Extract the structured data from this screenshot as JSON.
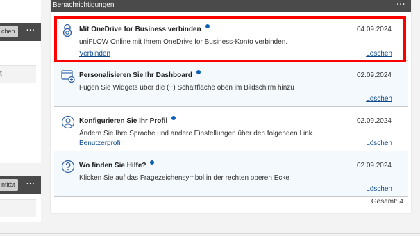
{
  "left": {
    "button_partial": "chen",
    "menu_dots": "···",
    "row_text": "t",
    "bottom_button_partial": "ntität",
    "bottom_menu_dots": "···"
  },
  "panel": {
    "title": "Benachrichtigungen",
    "menu_dots": "···",
    "total": "Gesamt: 4"
  },
  "notifications": [
    {
      "icon": "onedrive-lock-icon",
      "title": "Mit OneDrive for Business verbinden",
      "date": "04.09.2024",
      "description": "uniFLOW Online mit Ihrem OneDrive for Business-Konto verbinden.",
      "link": "Verbinden",
      "delete": "Löschen",
      "highlighted": true
    },
    {
      "icon": "dashboard-add-icon",
      "title": "Personalisieren Sie Ihr Dashboard",
      "date": "02.09.2024",
      "description": "Fügen Sie Widgets über die (+) Schaltfläche oben im Bildschirm hinzu",
      "link": "",
      "delete": "Löschen"
    },
    {
      "icon": "user-profile-icon",
      "title": "Konfigurieren Sie Ihr Profil",
      "date": "02.09.2024",
      "description": "Ändern Sie Ihre Sprache und andere Einstellungen über den folgenden Link.",
      "link": "Benutzerprofil",
      "delete": "Löschen"
    },
    {
      "icon": "help-question-icon",
      "title": "Wo finden Sie Hilfe?",
      "date": "02.09.2024",
      "description": "Klicken Sie auf das Fragezeichensymbol in der rechten oberen Ecke",
      "link": "",
      "delete": "Löschen"
    }
  ],
  "colors": {
    "header": "#4a4a4a",
    "unread_dot": "#0f5fb4",
    "link": "#0f4a8a",
    "highlight": "#ff0000",
    "alt_row": "#f4f9fd"
  }
}
